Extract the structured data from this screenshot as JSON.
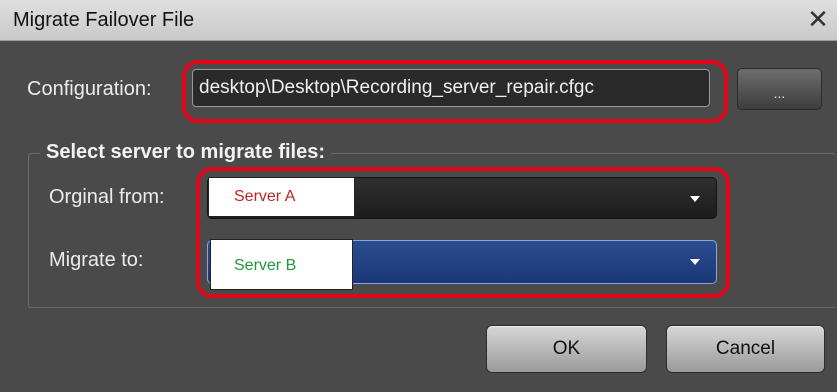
{
  "window": {
    "title": "Migrate Failover File",
    "close_glyph": "✕"
  },
  "configuration": {
    "label": "Configuration:",
    "value": "desktop\\Desktop\\Recording_server_repair.cfgc",
    "browse_label": "..."
  },
  "group": {
    "title": "Select server to migrate files:",
    "original_from_label": "Orginal from:",
    "original_from_value": "Server A",
    "migrate_to_label": "Migrate to:",
    "migrate_to_value": "Server B"
  },
  "buttons": {
    "ok": "OK",
    "cancel": "Cancel"
  },
  "colors": {
    "highlight": "#e2061b",
    "server_a_text": "#c0261f",
    "server_b_text": "#1f9a3a",
    "selected_combo": "#1b3878"
  }
}
